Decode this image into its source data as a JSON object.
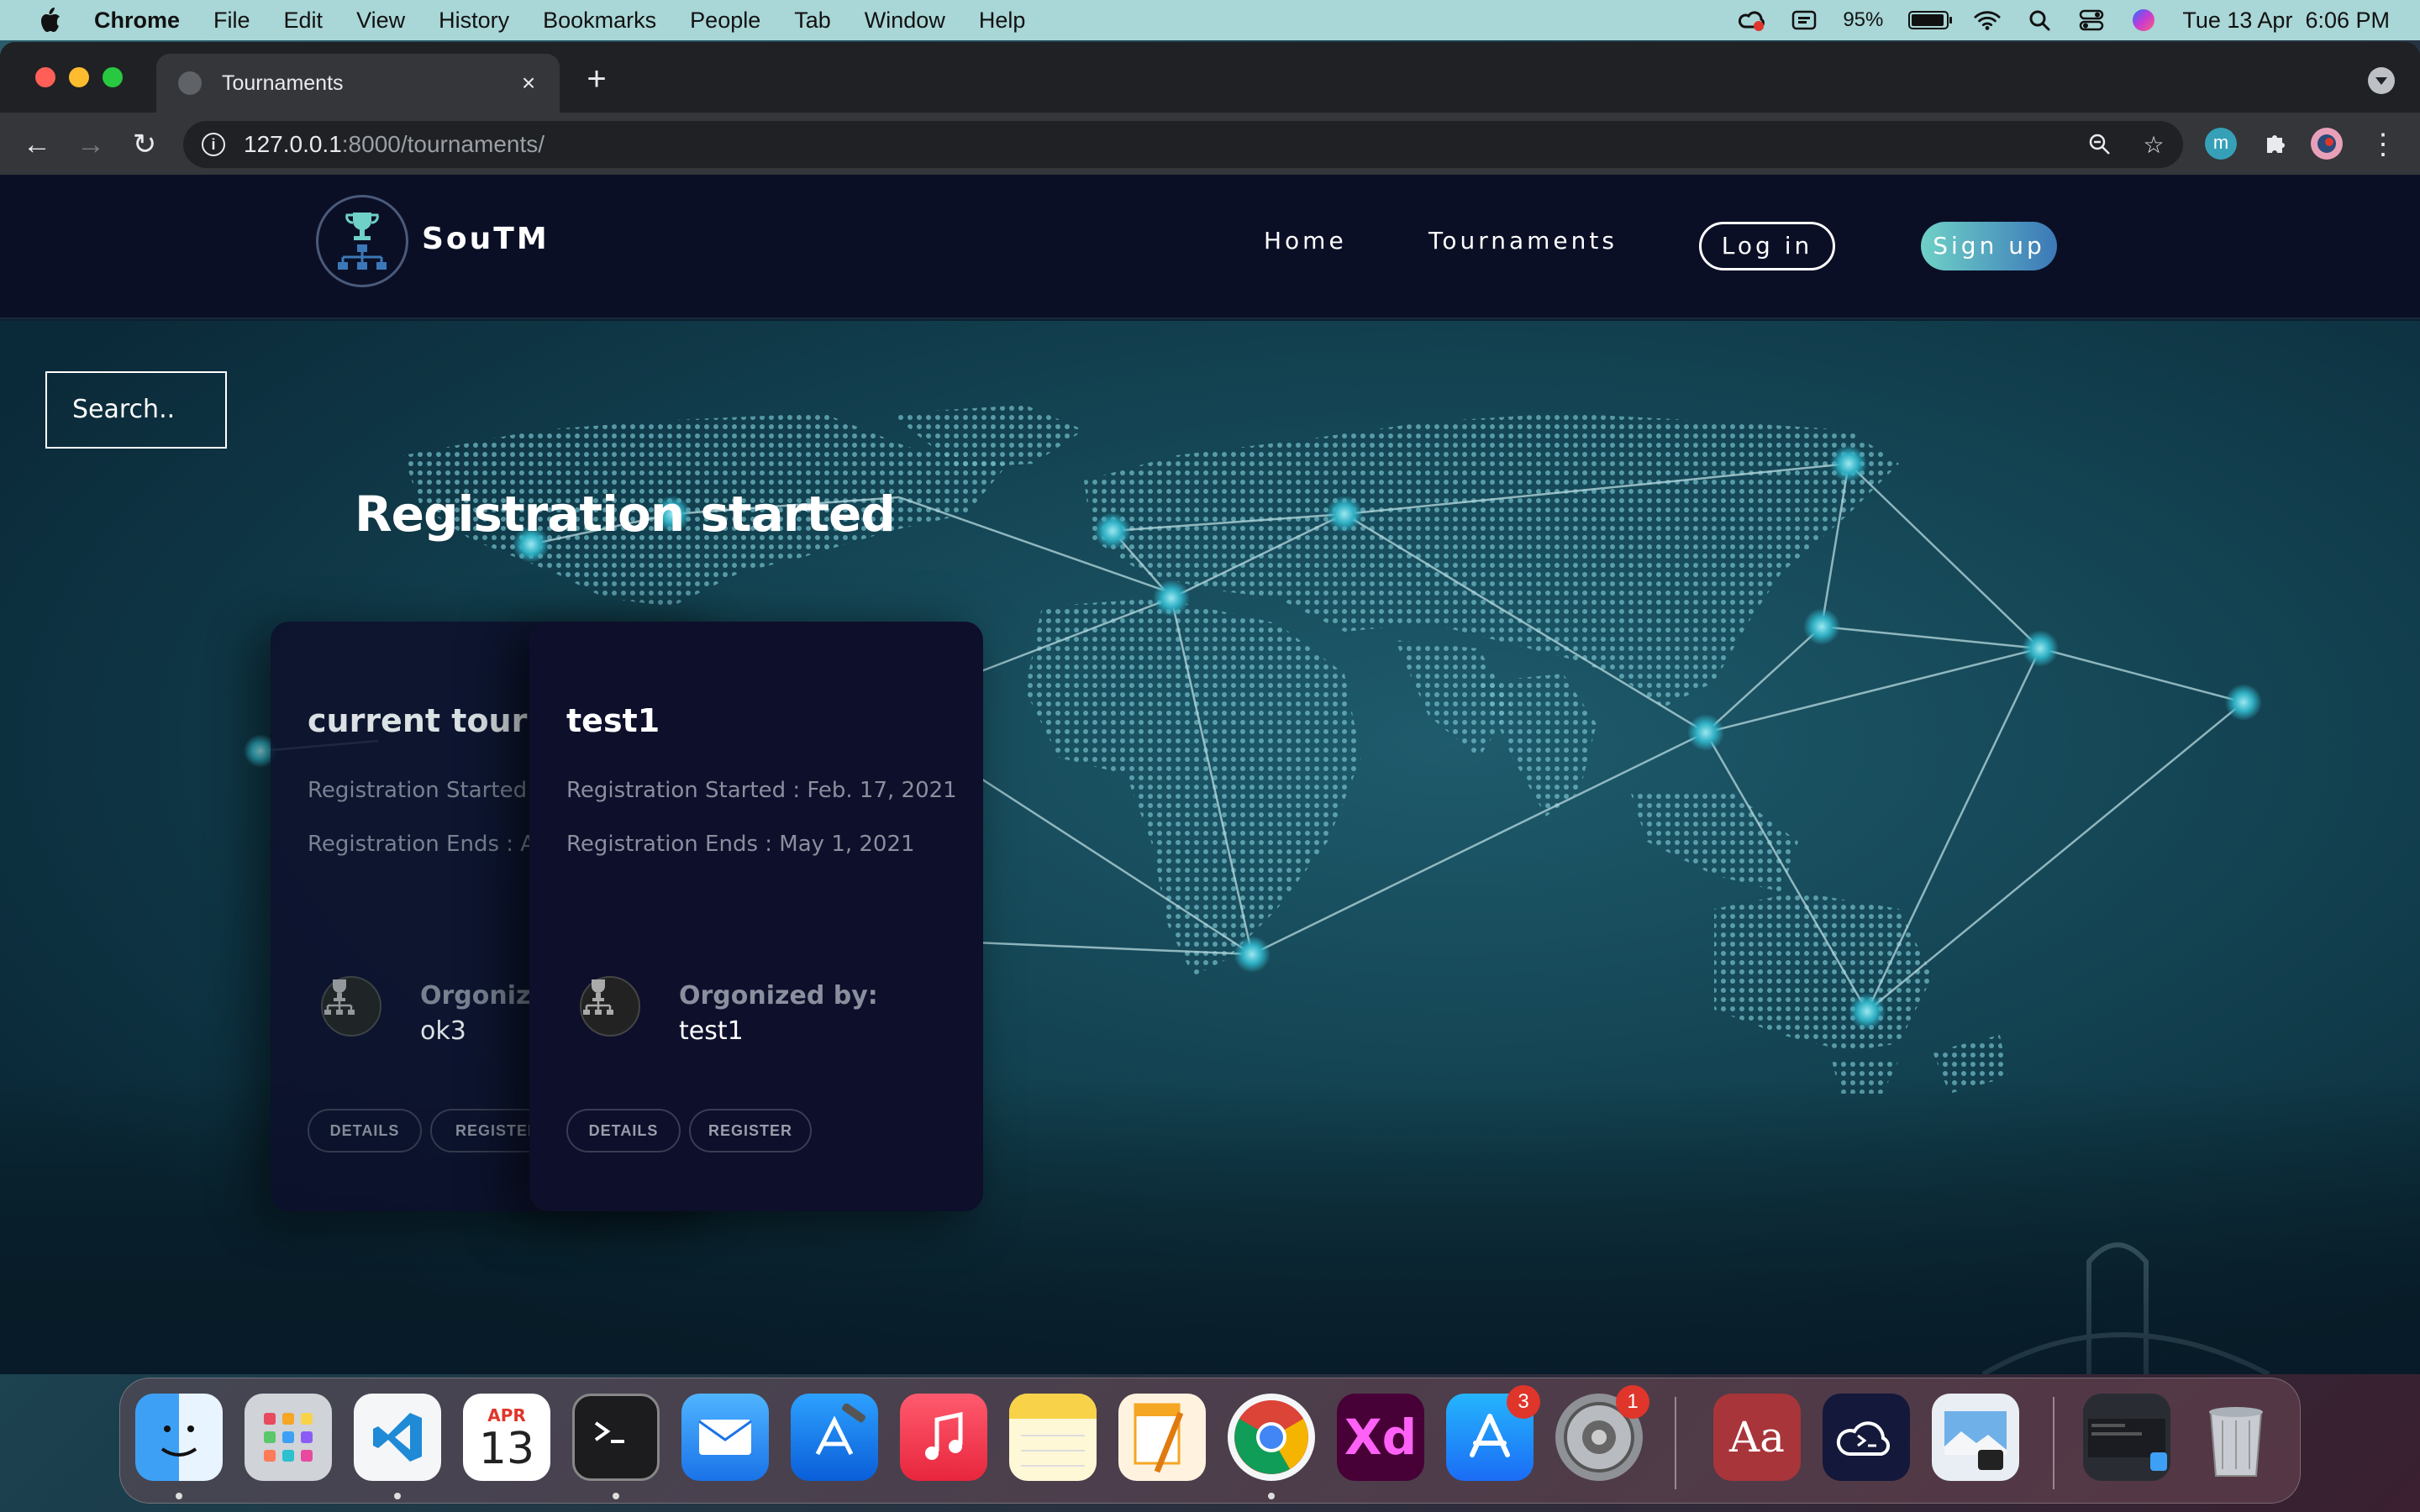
{
  "menubar": {
    "app_name": "Chrome",
    "items": [
      "File",
      "Edit",
      "View",
      "History",
      "Bookmarks",
      "People",
      "Tab",
      "Window",
      "Help"
    ],
    "battery": "95%",
    "datetime": "Tue 13 Apr  6:06 PM"
  },
  "browser": {
    "tab_title": "Tournaments",
    "url_host": "127.0.0.1",
    "url_rest": ":8000/tournaments/",
    "profile_initial": "m"
  },
  "site": {
    "brand": "SouTM",
    "nav": {
      "home": "Home",
      "tournaments": "Tournaments",
      "login": "Log in",
      "signup": "Sign up"
    },
    "search_placeholder": "Search..",
    "section_title": "Registration started",
    "cards": [
      {
        "title": "current tournament",
        "registration_started": "Registration Started : ",
        "registration_ends": "Registration Ends : Au",
        "organized_label": "Orgonized by:",
        "organizer": "ok3",
        "details_label": "DETAILS",
        "register_label": "REGISTER"
      },
      {
        "title": "test1",
        "registration_started": "Registration Started : Feb. 17, 2021",
        "registration_ends": "Registration Ends : May 1, 2021",
        "organized_label": "Orgonized by:",
        "organizer": "test1",
        "details_label": "DETAILS",
        "register_label": "REGISTER"
      }
    ]
  },
  "dock": {
    "calendar_month": "APR",
    "calendar_day": "13",
    "xd_label": "Xd",
    "dictionary_label": "Aa",
    "app_store_badge": "3",
    "settings_badge": "1"
  },
  "colors": {
    "header_bg": "#0b0f26",
    "card_bg": "#0d0f2b",
    "signup_gradient_start": "#6fd1c7",
    "signup_gradient_end": "#3b78b8",
    "hero_teal": "#1e5b6c"
  }
}
